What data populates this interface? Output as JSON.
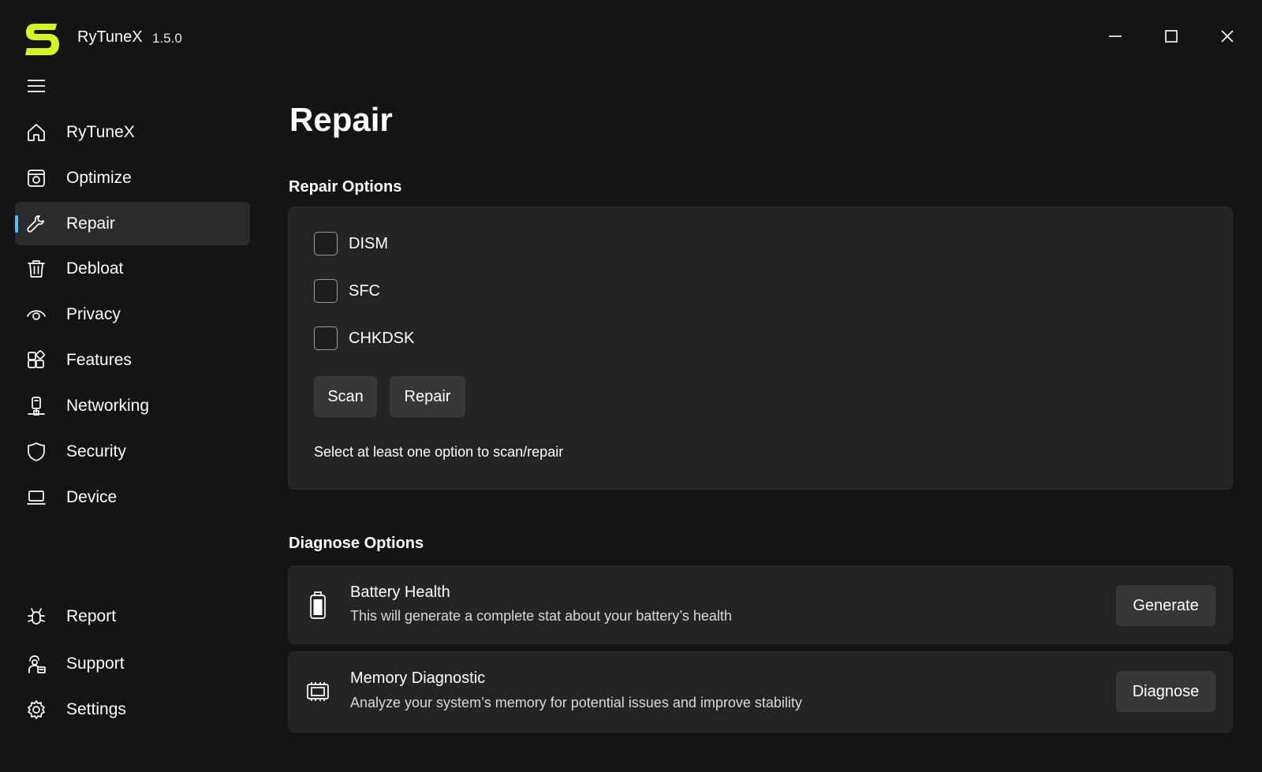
{
  "app": {
    "name": "RyTuneX",
    "version": "1.5.0"
  },
  "colors": {
    "accent": "#4cc2ff",
    "logo": "#d4f51f",
    "background": "#141414",
    "card": "#242424"
  },
  "window_controls": [
    "minimize-icon",
    "maximize-icon",
    "close-icon"
  ],
  "sidebar": {
    "items": [
      {
        "label": "RyTuneX",
        "icon": "home-icon"
      },
      {
        "label": "Optimize",
        "icon": "optimize-icon"
      },
      {
        "label": "Repair",
        "icon": "wrench-icon",
        "active": true
      },
      {
        "label": "Debloat",
        "icon": "trash-icon"
      },
      {
        "label": "Privacy",
        "icon": "eye-icon"
      },
      {
        "label": "Features",
        "icon": "apps-icon"
      },
      {
        "label": "Networking",
        "icon": "network-icon"
      },
      {
        "label": "Security",
        "icon": "shield-icon"
      },
      {
        "label": "Device",
        "icon": "laptop-icon"
      }
    ],
    "footer": [
      {
        "label": "Report",
        "icon": "bug-icon"
      },
      {
        "label": "Support",
        "icon": "support-icon"
      },
      {
        "label": "Settings",
        "icon": "gear-icon"
      }
    ]
  },
  "main": {
    "title": "Repair",
    "repair_section": {
      "title": "Repair Options",
      "options": [
        {
          "label": "DISM",
          "checked": false
        },
        {
          "label": "SFC",
          "checked": false
        },
        {
          "label": "CHKDSK",
          "checked": false
        }
      ],
      "scan_label": "Scan",
      "repair_label": "Repair",
      "hint": "Select at least one option to scan/repair"
    },
    "diagnose_section": {
      "title": "Diagnose Options",
      "items": [
        {
          "title": "Battery Health",
          "description": "This will generate a complete stat about your battery’s health",
          "button": "Generate",
          "icon": "battery-icon"
        },
        {
          "title": "Memory Diagnostic",
          "description": "Analyze your system’s memory for potential issues and improve stability",
          "button": "Diagnose",
          "icon": "memory-icon"
        }
      ]
    }
  }
}
